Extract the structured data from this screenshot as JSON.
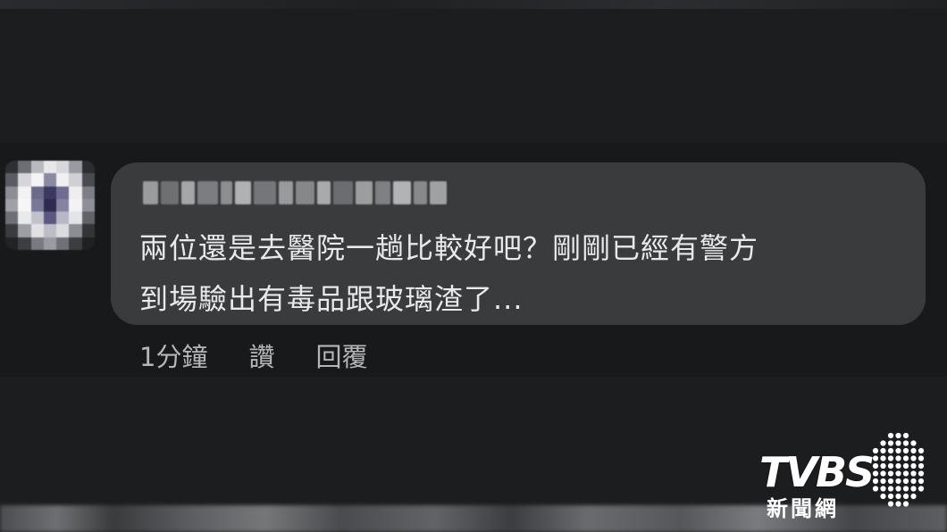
{
  "comment": {
    "text_line_1": "兩位還是去醫院一趟比較好吧？剛剛已經有警方",
    "text_line_2": "到場驗出有毒品跟玻璃渣了...",
    "timestamp": "1分鐘",
    "like_label": "讚",
    "reply_label": "回覆"
  },
  "watermark": {
    "brand": "TVBS",
    "subtitle": "新聞網"
  },
  "colors": {
    "background": "#1c1d1f",
    "bubble": "#3a3b3c",
    "text": "#e8e9eb",
    "meta_text": "#b4b6b9"
  }
}
